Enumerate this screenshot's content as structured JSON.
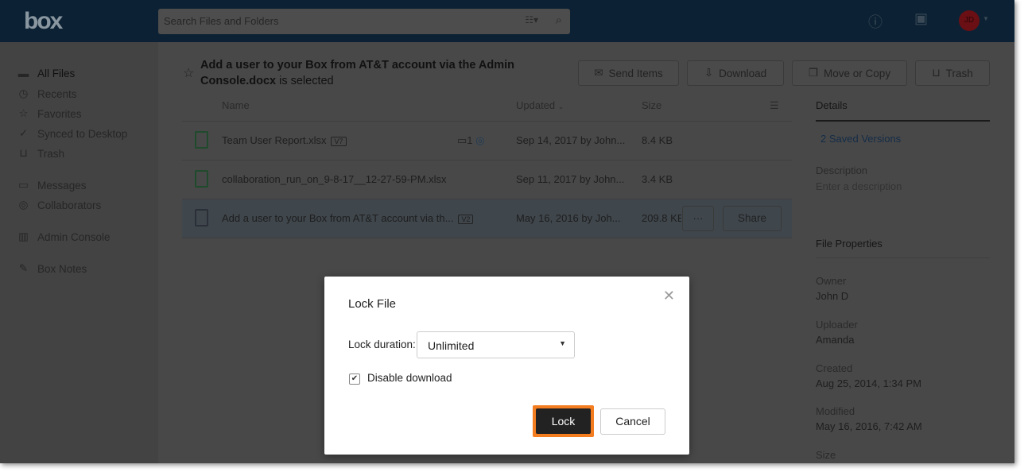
{
  "header": {
    "logo": "box",
    "search_placeholder": "Search Files and Folders",
    "avatar_initials": "JD"
  },
  "sidebar": {
    "items": [
      {
        "label": "All Files",
        "icon": "folder-icon",
        "glyph": "▬"
      },
      {
        "label": "Recents",
        "icon": "clock-icon",
        "glyph": "◷"
      },
      {
        "label": "Favorites",
        "icon": "star-icon",
        "glyph": "☆"
      },
      {
        "label": "Synced to Desktop",
        "icon": "check-circle-icon",
        "glyph": "✓"
      },
      {
        "label": "Trash",
        "icon": "trash-icon",
        "glyph": "⊔"
      },
      {
        "label": "Messages",
        "icon": "message-icon",
        "glyph": "▭"
      },
      {
        "label": "Collaborators",
        "icon": "user-icon",
        "glyph": "◎"
      },
      {
        "label": "Admin Console",
        "icon": "admin-icon",
        "glyph": "▥"
      },
      {
        "label": "Box Notes",
        "icon": "notes-icon",
        "glyph": "✎"
      }
    ]
  },
  "selection": {
    "name": "Add a user to your Box from AT&T account via the Admin Console.docx",
    "suffix": " is selected"
  },
  "toolbar": {
    "send": "Send Items",
    "download": "Download",
    "move": "Move or Copy",
    "trash": "Trash"
  },
  "columns": {
    "name": "Name",
    "updated": "Updated",
    "size": "Size"
  },
  "files": [
    {
      "name": "Team User Report.xlsx",
      "version": "V7",
      "comments": "1",
      "updated": "Sep 14, 2017 by John...",
      "size": "8.4 KB"
    },
    {
      "name": "collaboration_run_on_9-8-17__12-27-59-PM.xlsx",
      "version": "",
      "updated": "Sep 11, 2017 by John...",
      "size": "3.4 KB"
    },
    {
      "name": "Add a user to your Box from AT&T account via th...",
      "version": "V2",
      "updated": "May 16, 2016 by Joh...",
      "size": "209.8 KB",
      "more": "···",
      "share": "Share"
    }
  ],
  "details": {
    "tab": "Details",
    "versions": "2 Saved Versions",
    "description_label": "Description",
    "description_placeholder": "Enter a description",
    "properties": "File Properties",
    "owner_label": "Owner",
    "owner": "John D",
    "uploader_label": "Uploader",
    "uploader": "Amanda",
    "created_label": "Created",
    "created": "Aug 25, 2014, 1:34 PM",
    "modified_label": "Modified",
    "modified": "May 16, 2016, 7:42 AM",
    "size_label": "Size"
  },
  "modal": {
    "title": "Lock File",
    "duration_label": "Lock duration:",
    "duration_value": "Unlimited",
    "disable_download": "Disable download",
    "disable_download_checked": true,
    "lock": "Lock",
    "cancel": "Cancel",
    "accent": "#f47d20"
  }
}
